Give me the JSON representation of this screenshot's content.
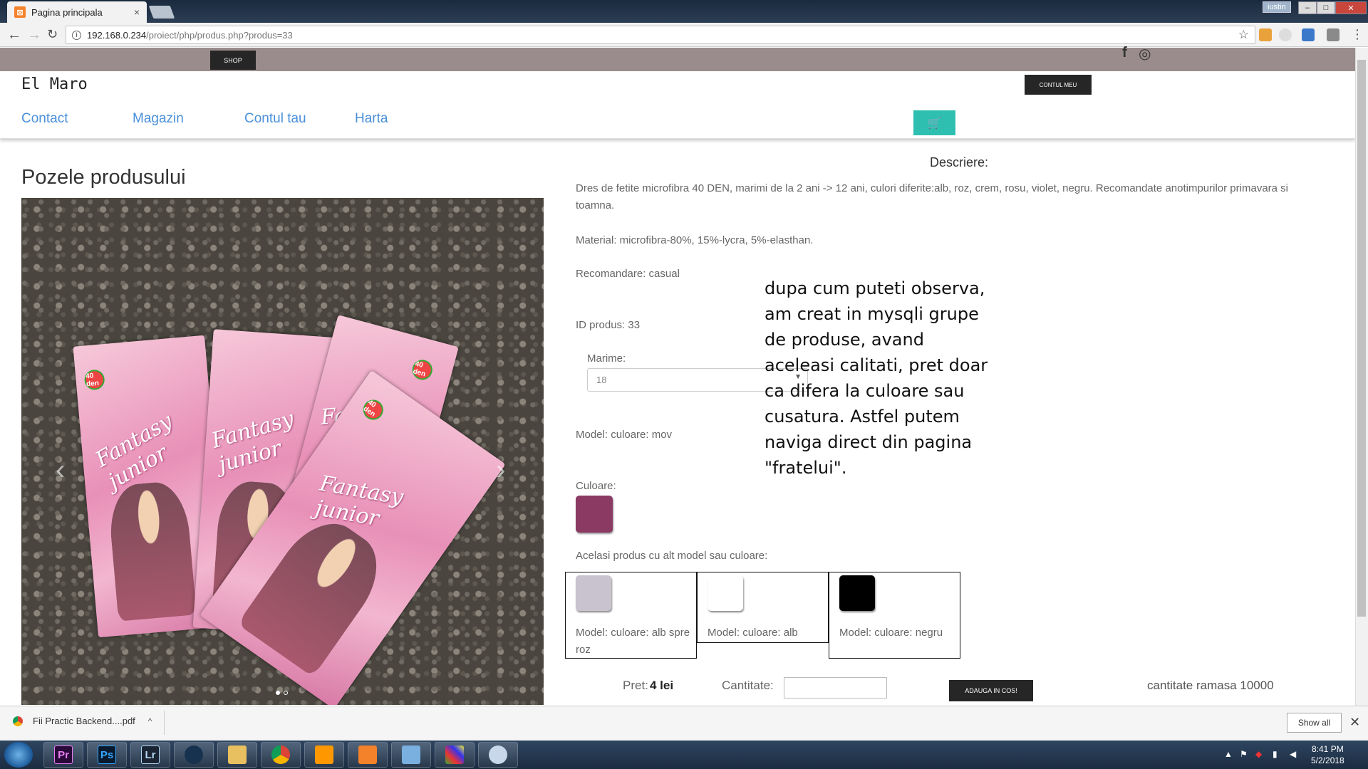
{
  "browser": {
    "tab_title": "Pagina principala",
    "tab_close": "×",
    "favicon": "⊠",
    "url_host": "192.168.0.234",
    "url_path": "/proiect/php/produs.php?produs=33",
    "user_badge": "iustin",
    "win_min": "–",
    "win_max": "□",
    "win_close": "✕"
  },
  "site": {
    "shop_button": "SHOP",
    "brand": "El Maro",
    "account_button": "CONTUL MEU",
    "social": [
      "f",
      "◎"
    ],
    "nav": [
      "Contact",
      "Magazin",
      "Contul tau",
      "Harta"
    ],
    "cart_icon": "🛒"
  },
  "product": {
    "photos_title": "Pozele produsului",
    "description_title": "Descriere:",
    "description": "Dres de fetite microfibra 40 DEN, marimi de la 2 ani -> 12 ani, culori diferite:alb, roz, crem, rosu, violet, negru. Recomandate anotimpurilor primavara si toamna.",
    "material": "Material: microfibra-80%, 15%-lycra, 5%-elasthan.",
    "recommendation": "Recomandare: casual",
    "product_id": "ID produs: 33",
    "size_label": "Marime:",
    "size_value": "18",
    "model": "Model: culoare: mov",
    "color_label": "Culoare:",
    "color_hex": "#8b3a64",
    "variants_label": "Acelasi produs cu alt model sau culoare:",
    "variants": [
      {
        "label": "Model: culoare: alb spre roz",
        "color": "#c9c3cf"
      },
      {
        "label": "Model: culoare: alb",
        "color": "#ffffff"
      },
      {
        "label": "Model: culoare: negru",
        "color": "#000000"
      }
    ],
    "price_label": "Pret:",
    "price_value": "4 lei",
    "quantity_label": "Cantitate:",
    "add_button": "ADAUGA IN COS!",
    "remaining": "cantitate ramasa 10000",
    "photo_pack_text": "Fantasy junior",
    "photo_badge": "40 den"
  },
  "annotation": "dupa cum puteti observa, am creat in mysqli grupe de produse, avand aceleasi calitati, pret doar ca difera la culoare sau cusatura. Astfel putem naviga direct din pagina \"fratelui\".",
  "downloads": {
    "file_name": "Fii Practic Backend....pdf",
    "show_all": "Show all",
    "close": "✕"
  },
  "taskbar": {
    "apps": [
      "Pr",
      "Ps",
      "Lr"
    ],
    "time": "8:41 PM",
    "date": "5/2/2018"
  }
}
